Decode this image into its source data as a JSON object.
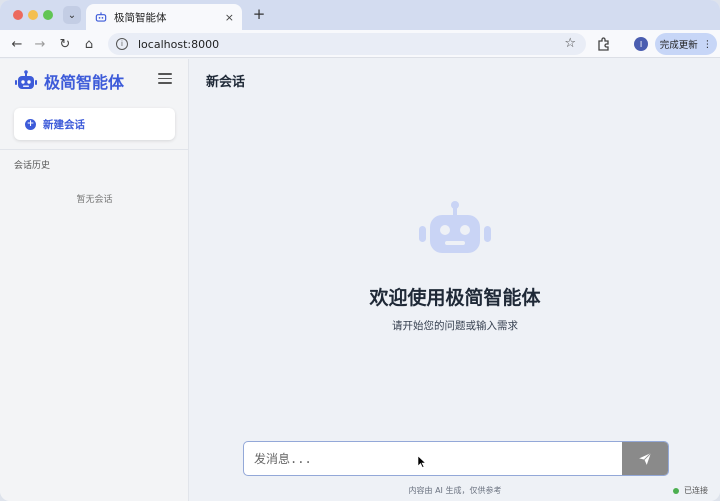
{
  "browser": {
    "tab_title": "极简智能体",
    "tab_close": "×",
    "new_tab": "+",
    "url": "localhost:8000",
    "profile_initial": "I",
    "update_label": "完成更新",
    "nav": {
      "back": "←",
      "forward": "→",
      "reload": "↻",
      "home": "⌂"
    },
    "star": "☆"
  },
  "sidebar": {
    "brand": "极简智能体",
    "new_chat_label": "新建会话",
    "history_title": "会话历史",
    "history_empty": "暂无会话"
  },
  "main": {
    "page_title": "新会话",
    "welcome_title": "欢迎使用极简智能体",
    "welcome_subtitle": "请开始您的问题或输入需求",
    "input_placeholder": "发消息...",
    "footer_note": "内容由 AI 生成，仅供参考",
    "status_text": "已连接"
  },
  "colors": {
    "accent": "#3d5bd9",
    "bot_icon": "#c9d4f5",
    "status_online": "#4caf50"
  },
  "icons": [
    "robot-icon",
    "menu-icon",
    "plus-circle-icon",
    "send-icon",
    "info-icon",
    "star-icon",
    "extension-icon"
  ]
}
